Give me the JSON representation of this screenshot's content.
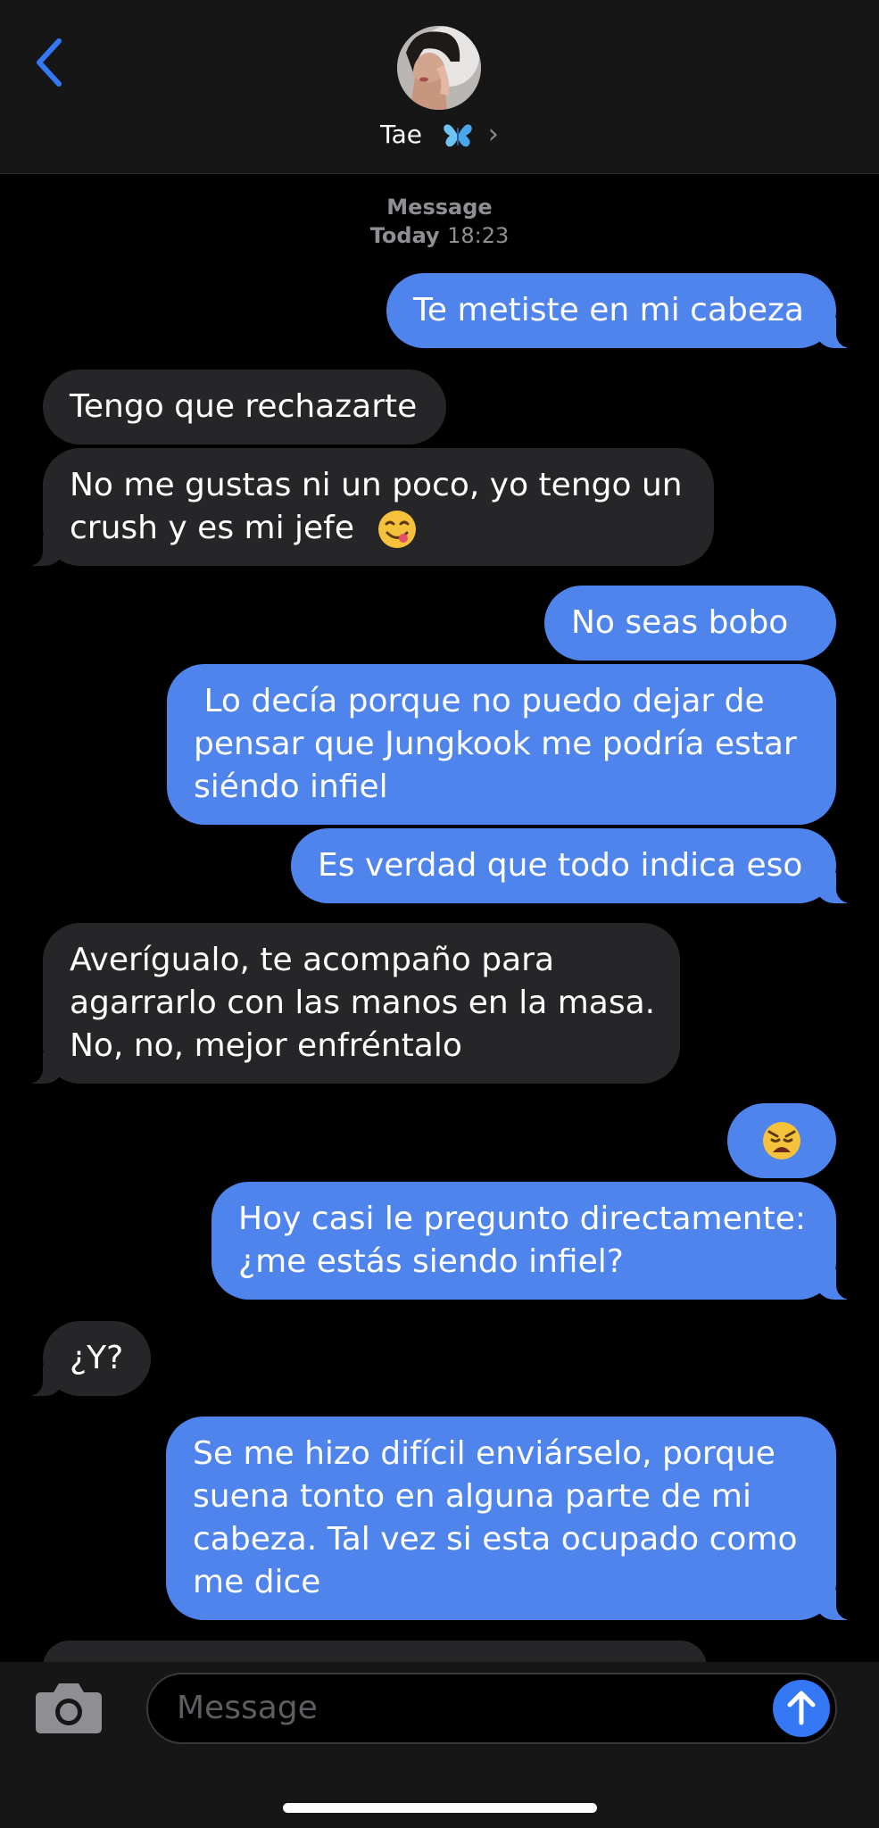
{
  "header": {
    "contact_name": "Tae",
    "contact_emoji_icon": "butterfly-icon",
    "chevron": "›"
  },
  "thread": {
    "service": "Message",
    "timestamp_day": "Today",
    "timestamp_time": "18:23"
  },
  "messages": [
    {
      "side": "out",
      "lines": [
        "Te metiste en mi cabeza"
      ]
    },
    {
      "side": "in",
      "lines": [
        "Tengo que rechazarte"
      ]
    },
    {
      "side": "in",
      "lines": [
        "No me gustas ni un poco, yo tengo un",
        "crush y es mi jefe"
      ],
      "emoji": "yum-face-emoji"
    },
    {
      "side": "out",
      "lines": [
        "No seas bobo"
      ]
    },
    {
      "side": "out",
      "lines": [
        " Lo decía porque no puedo dejar de",
        "pensar que Jungkook me podría estar",
        "siéndo infiel"
      ]
    },
    {
      "side": "out",
      "lines": [
        "Es verdad que todo indica eso"
      ]
    },
    {
      "side": "in",
      "lines": [
        "Averígualo, te acompaño para",
        "agarrarlo con las manos en la masa.",
        "No, no, mejor enfréntalo"
      ]
    },
    {
      "side": "out",
      "lines": [],
      "emoji": "weary-face-emoji"
    },
    {
      "side": "out",
      "lines": [
        "Hoy casi le pregunto directamente:",
        "¿me estás siendo infiel?"
      ]
    },
    {
      "side": "in",
      "lines": [
        "¿Y?"
      ]
    },
    {
      "side": "out",
      "lines": [
        "Se me hizo difícil enviárselo, porque",
        "suena tonto en alguna parte de mi",
        "cabeza. Tal vez si esta ocupado como",
        "me dice"
      ]
    }
  ],
  "composer": {
    "placeholder": "Message",
    "camera_icon": "camera-icon",
    "send_icon": "send-arrow-icon"
  },
  "colors": {
    "outgoing": "#4f84ec",
    "incoming": "#262629",
    "accent": "#3478f6"
  }
}
